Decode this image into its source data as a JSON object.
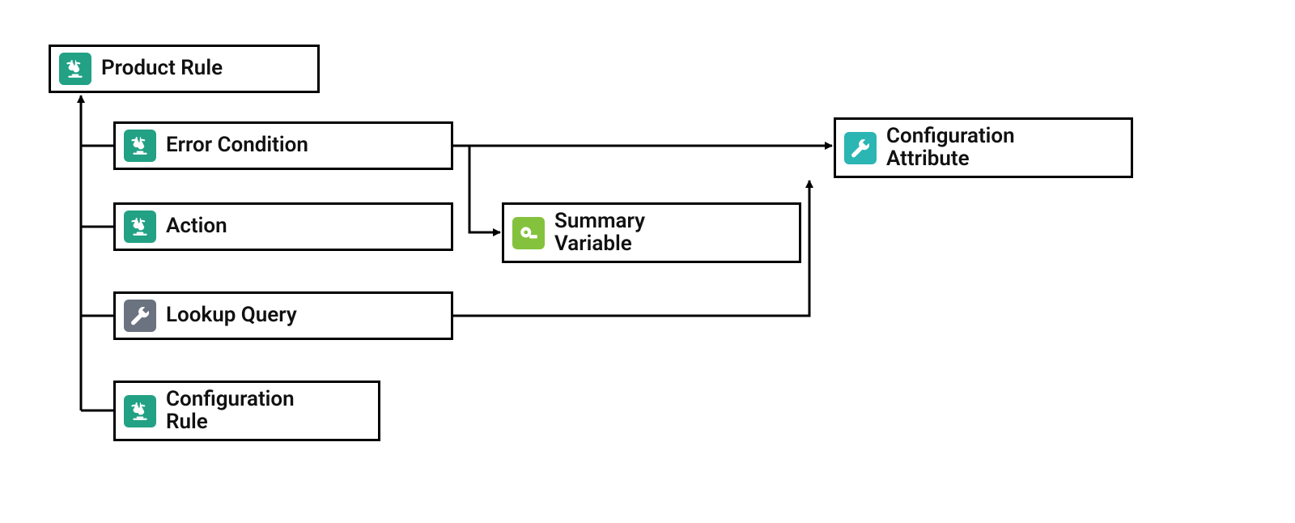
{
  "nodes": {
    "product_rule": {
      "label": "Product Rule"
    },
    "error_condition": {
      "label": "Error Condition"
    },
    "action": {
      "label": "Action"
    },
    "lookup_query": {
      "label": "Lookup Query"
    },
    "configuration_rule": {
      "label": "Configuration\nRule"
    },
    "summary_variable": {
      "label": "Summary\nVariable"
    },
    "configuration_attribute": {
      "label": "Configuration\nAttribute"
    }
  },
  "colors": {
    "scales_icon": "#22a184",
    "wrench_gray": "#6b7280",
    "wrench_teal": "#2bb5b3",
    "tape_green": "#84c23d"
  },
  "diagram": {
    "type": "entity-relationship",
    "edges": [
      {
        "from": "error_condition",
        "to": "product_rule"
      },
      {
        "from": "action",
        "to": "product_rule"
      },
      {
        "from": "lookup_query",
        "to": "product_rule"
      },
      {
        "from": "configuration_rule",
        "to": "product_rule"
      },
      {
        "from": "error_condition",
        "to": "summary_variable",
        "via": "right-then-down"
      },
      {
        "from": "error_condition",
        "to": "configuration_attribute"
      },
      {
        "from": "lookup_query",
        "to": "configuration_attribute",
        "via": "right-then-up"
      }
    ]
  }
}
